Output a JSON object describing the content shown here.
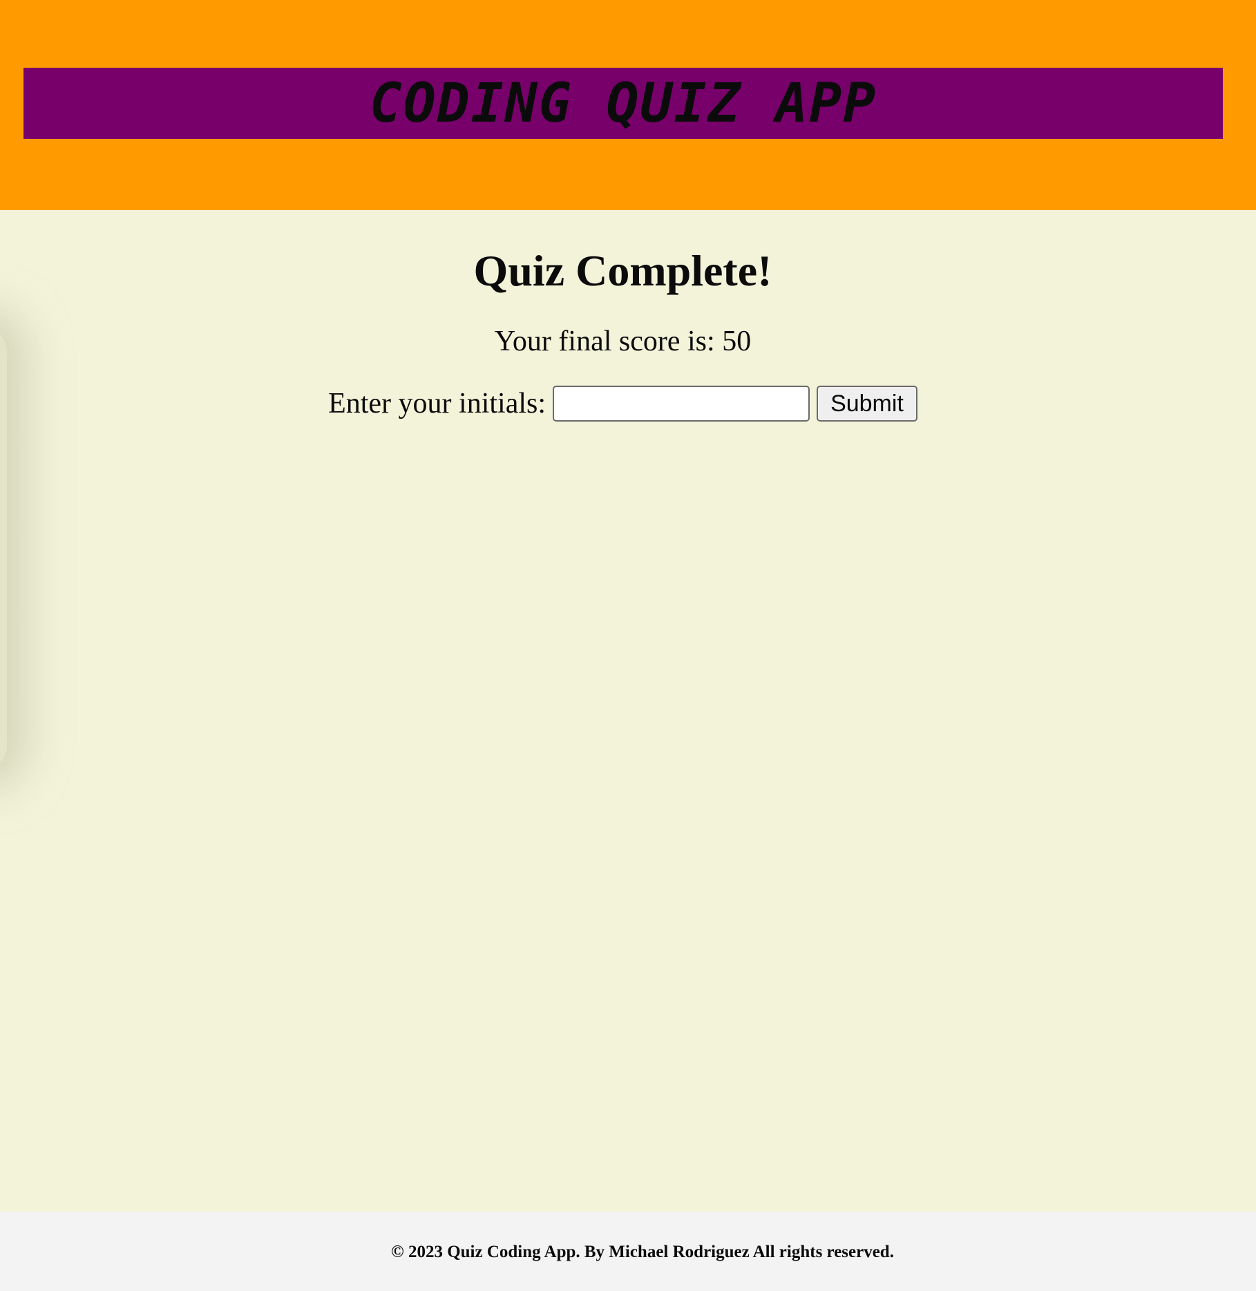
{
  "header": {
    "app_title": "CODING QUIZ APP"
  },
  "main": {
    "quiz_title": "Quiz Complete!",
    "score_prefix": "Your final score is: ",
    "score_value": "50",
    "initials_label": "Enter your initials:",
    "initials_value": "",
    "initials_placeholder": "",
    "submit_label": "Submit"
  },
  "footer": {
    "copyright": "© 2023 Quiz Coding App. By Michael Rodriguez All rights reserved."
  },
  "colors": {
    "header_bg": "#ff9b00",
    "title_bar_bg": "#78006a",
    "main_bg": "#f3f3da",
    "footer_bg": "#f3f3f3"
  }
}
